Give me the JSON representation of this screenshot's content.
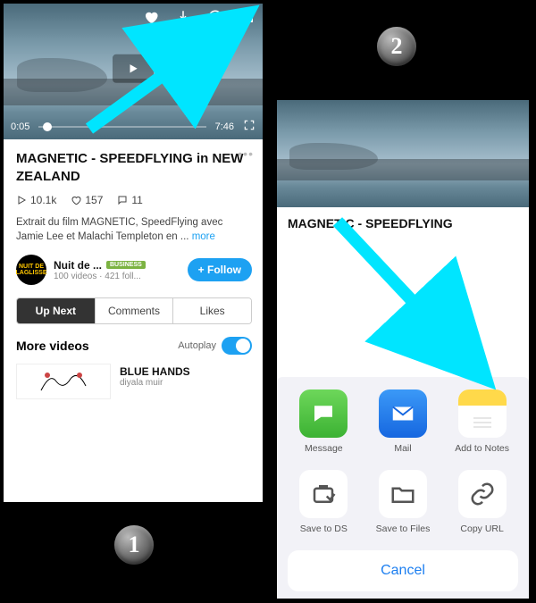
{
  "step1_label": "1",
  "step2_label": "2",
  "video": {
    "current_time": "0:05",
    "duration": "7:46",
    "title": "MAGNETIC - SPEEDFLYING in NEW ZEALAND",
    "plays": "10.1k",
    "likes": "157",
    "comments": "11",
    "description": "Extrait du film MAGNETIC, SpeedFlying avec Jamie Lee et Malachi Templeton en ... ",
    "more_label": "more"
  },
  "channel": {
    "avatar_text": "NUIT DE\nLAGLISSE",
    "name": "Nuit de ...",
    "badge": "BUSINESS",
    "meta": "100 videos · 421 foll...",
    "follow_label": "+  Follow"
  },
  "tabs": {
    "upnext": "Up Next",
    "comments": "Comments",
    "likes": "Likes"
  },
  "more_section": {
    "heading": "More videos",
    "autoplay_label": "Autoplay",
    "item_title": "BLUE HANDS",
    "item_by": "diyala muir"
  },
  "panel2_title": "MAGNETIC - SPEEDFLYING",
  "share": {
    "row1": {
      "message": "Message",
      "mail": "Mail",
      "notes": "Add to Notes"
    },
    "row2": {
      "save_ds": "Save to DS",
      "save_files": "Save to Files",
      "copy_url": "Copy URL"
    },
    "cancel": "Cancel"
  }
}
